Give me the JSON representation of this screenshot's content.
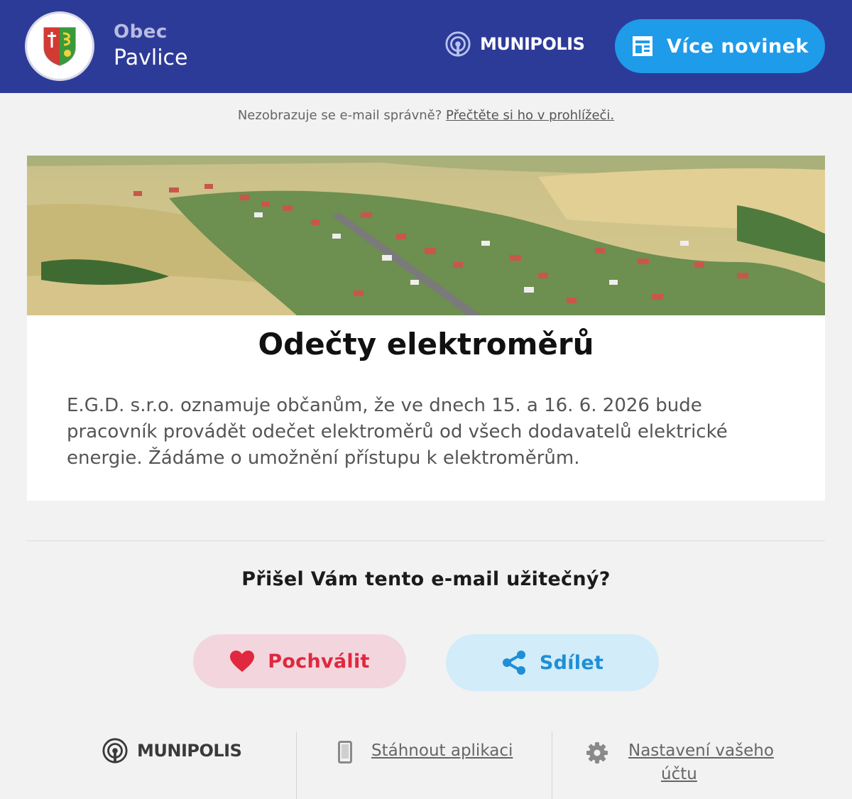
{
  "header": {
    "brand_top": "Obec",
    "brand_name": "Pavlice",
    "logo_icon": "municipality-crest-icon",
    "munipolis_label": "MUNIPOLIS",
    "more_button_label": "Více novinek",
    "colors": {
      "header_bg": "#2d3b98",
      "button_bg": "#1e9be9"
    }
  },
  "notice": {
    "text": "Nezobrazuje se e-mail správně? ",
    "link": "Přečtěte si ho v prohlížeči."
  },
  "article": {
    "hero_image": "aerial-village-photo",
    "title": "Odečty elektroměrů",
    "body": "E.G.D. s.r.o. oznamuje občanům, že ve dnech 15. a 16. 6. 2026 bude pracovník provádět odečet elektroměrů od všech dodavatelů elektrické energie. Žádáme o umožnění přístupu k elektroměrům."
  },
  "feedback": {
    "question": "Přišel Vám tento e-mail užitečný?",
    "praise_label": "Pochválit",
    "share_label": "Sdílet",
    "colors": {
      "praise": "#e0283f",
      "share": "#1e8fd6"
    }
  },
  "footer": {
    "munipolis_label": "MUNIPOLIS",
    "download_app": "Stáhnout aplikaci",
    "account_settings_line1": "Nastavení vašeho",
    "account_settings_line2": "účtu"
  }
}
